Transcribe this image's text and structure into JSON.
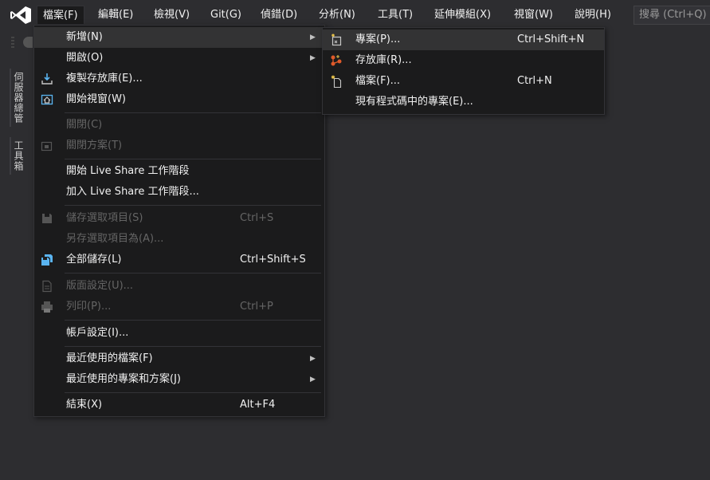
{
  "menubar": {
    "items": [
      "檔案(F)",
      "編輯(E)",
      "檢視(V)",
      "Git(G)",
      "偵錯(D)",
      "分析(N)",
      "工具(T)",
      "延伸模組(X)",
      "視窗(W)",
      "說明(H)"
    ],
    "search_placeholder": "搜尋 (Ctrl+Q)"
  },
  "side_tabs": [
    "伺服器總管",
    "工具箱"
  ],
  "file_menu": {
    "items": [
      {
        "label": "新增(N)",
        "shortcut": "",
        "submenu": true,
        "icon": "none"
      },
      {
        "label": "開啟(O)",
        "shortcut": "",
        "submenu": true,
        "icon": "none"
      },
      {
        "label": "複製存放庫(E)...",
        "shortcut": "",
        "icon": "clone-download-icon"
      },
      {
        "label": "開始視窗(W)",
        "shortcut": "",
        "icon": "start-window-icon"
      },
      {
        "label": "關閉(C)",
        "shortcut": "",
        "disabled": true,
        "icon": "none"
      },
      {
        "label": "關閉方案(T)",
        "shortcut": "",
        "disabled": true,
        "icon": "close-solution-icon"
      },
      {
        "label": "開始 Live Share 工作階段",
        "shortcut": "",
        "icon": "none"
      },
      {
        "label": "加入 Live Share 工作階段...",
        "shortcut": "",
        "icon": "none"
      },
      {
        "label": "儲存選取項目(S)",
        "shortcut": "Ctrl+S",
        "disabled": true,
        "icon": "save-icon"
      },
      {
        "label": "另存選取項目為(A)...",
        "shortcut": "",
        "disabled": true,
        "icon": "none"
      },
      {
        "label": "全部儲存(L)",
        "shortcut": "Ctrl+Shift+S",
        "icon": "save-all-icon"
      },
      {
        "label": "版面設定(U)...",
        "shortcut": "",
        "disabled": true,
        "icon": "page-setup-icon"
      },
      {
        "label": "列印(P)...",
        "shortcut": "Ctrl+P",
        "disabled": true,
        "icon": "print-icon"
      },
      {
        "label": "帳戶設定(I)...",
        "shortcut": "",
        "icon": "none"
      },
      {
        "label": "最近使用的檔案(F)",
        "shortcut": "",
        "submenu": true,
        "icon": "none"
      },
      {
        "label": "最近使用的專案和方案(J)",
        "shortcut": "",
        "submenu": true,
        "icon": "none"
      },
      {
        "label": "結束(X)",
        "shortcut": "Alt+F4",
        "icon": "none"
      }
    ]
  },
  "new_submenu": {
    "items": [
      {
        "label": "專案(P)...",
        "shortcut": "Ctrl+Shift+N",
        "icon": "new-project-icon"
      },
      {
        "label": "存放庫(R)...",
        "shortcut": "",
        "icon": "repository-icon"
      },
      {
        "label": "檔案(F)...",
        "shortcut": "Ctrl+N",
        "icon": "new-file-icon"
      },
      {
        "label": "現有程式碼中的專案(E)...",
        "shortcut": "",
        "icon": "none"
      }
    ]
  },
  "colors": {
    "background": "#2d2d30",
    "menu_bg": "#1b1b1c",
    "hover": "#333334",
    "disabled_text": "#656565",
    "logo": "#ffffff",
    "icon_blue": "#5ab4f0"
  }
}
